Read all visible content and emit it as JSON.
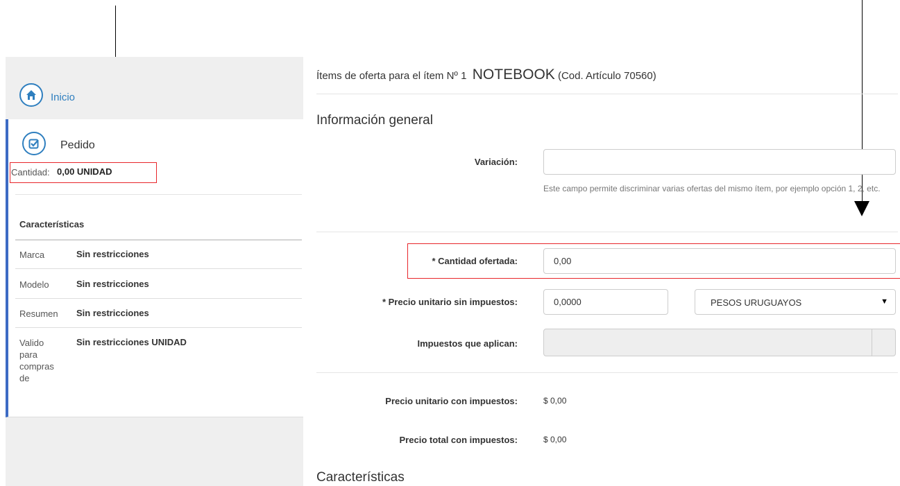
{
  "sidebar": {
    "home_label": "Inicio",
    "order_label": "Pedido",
    "quantity_label": "Cantidad:",
    "quantity_value": "0,00 UNIDAD",
    "features_heading": "Características",
    "features": [
      {
        "label": "Marca",
        "value": "Sin restricciones"
      },
      {
        "label": "Modelo",
        "value": "Sin restricciones"
      },
      {
        "label": "Resumen",
        "value": "Sin restricciones"
      },
      {
        "label": "Valido para compras de",
        "value": "Sin restricciones UNIDAD"
      }
    ]
  },
  "main": {
    "title_prefix": "Ítems de oferta para el ítem Nº 1",
    "item_name": "NOTEBOOK",
    "item_code": "(Cod. Artículo 70560)",
    "section_general": "Información general",
    "variation_label": "Variación:",
    "variation_value": "",
    "variation_help": "Este campo permite discriminar varias ofertas del mismo ítem, por ejemplo opción 1, 2, etc.",
    "qty_offered_label": "* Cantidad ofertada:",
    "qty_offered_value": "0,00",
    "unit_price_label": "* Precio unitario sin impuestos:",
    "unit_price_value": "0,0000",
    "currency_value": "PESOS URUGUAYOS",
    "taxes_label": "Impuestos que aplican:",
    "unit_price_tax_label": "Precio unitario con impuestos:",
    "unit_price_tax_value": "$ 0,00",
    "total_price_tax_label": "Precio total con impuestos:",
    "total_price_tax_value": "$ 0,00",
    "section_features": "Características"
  },
  "icons": {
    "home": "home-icon",
    "order": "checkbox-icon",
    "select_caret": "caret-down-icon"
  },
  "colors": {
    "accent_blue": "#2f7fbf",
    "panel_border": "#3d6bc4",
    "highlight_red": "#e8252a"
  }
}
